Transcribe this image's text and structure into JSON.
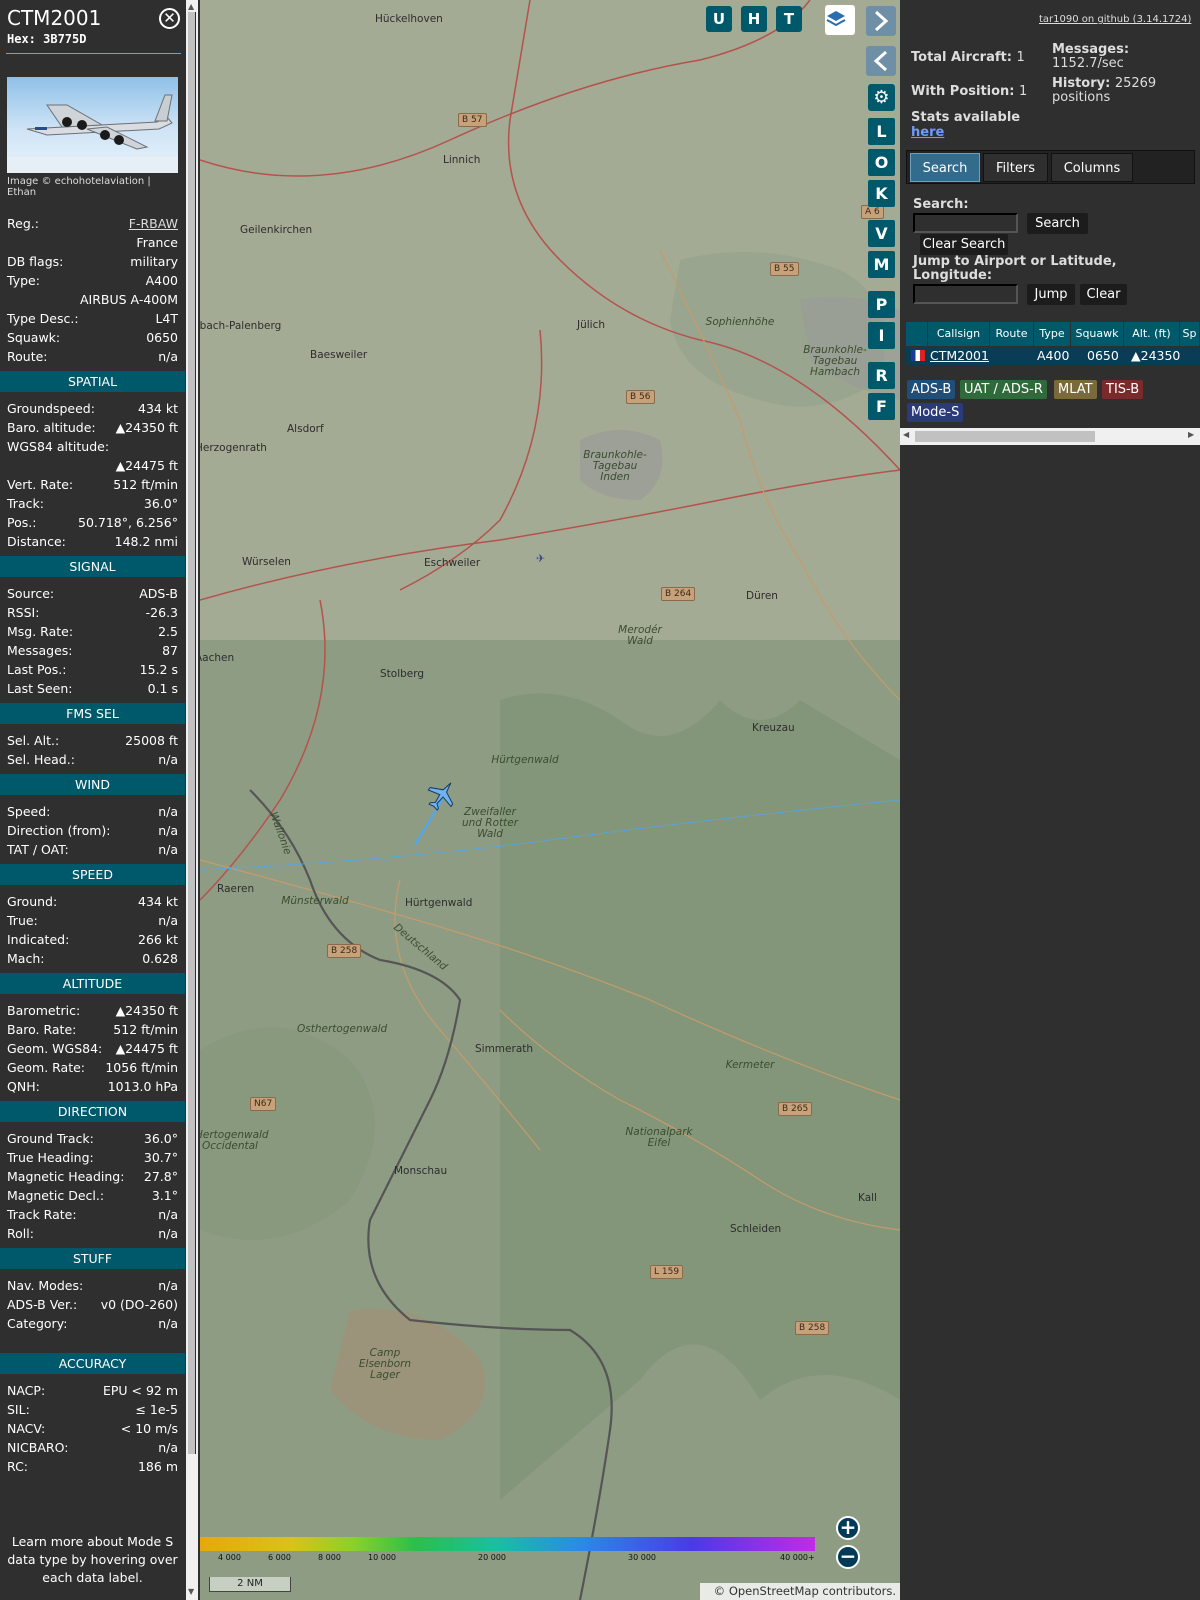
{
  "selected": {
    "callsign": "CTM2001",
    "hex": "Hex: 3B775D",
    "photo_credit": "Image © echohotelaviation | Ethan",
    "info": [
      {
        "k": "Reg.:",
        "v": "F-RBAW"
      },
      {
        "k": "",
        "v": "France"
      },
      {
        "k": "DB flags:",
        "v": "military"
      },
      {
        "k": "Type:",
        "v": "A400"
      },
      {
        "k": "",
        "v": "AIRBUS A-400M"
      },
      {
        "k": "Type Desc.:",
        "v": "L4T"
      },
      {
        "k": "Squawk:",
        "v": "0650"
      },
      {
        "k": "Route:",
        "v": "n/a"
      }
    ],
    "sections": [
      {
        "title": "SPATIAL",
        "rows": [
          {
            "k": "Groundspeed:",
            "v": "434 kt"
          },
          {
            "k": "Baro. altitude:",
            "v": "▲24350 ft"
          },
          {
            "k": "WGS84 altitude:",
            "v": ""
          },
          {
            "k": "",
            "v": "▲24475 ft"
          },
          {
            "k": "Vert. Rate:",
            "v": "512 ft/min"
          },
          {
            "k": "Track:",
            "v": "36.0°"
          },
          {
            "k": "Pos.:",
            "v": "50.718°, 6.256°"
          },
          {
            "k": "Distance:",
            "v": "148.2 nmi"
          }
        ]
      },
      {
        "title": "SIGNAL",
        "rows": [
          {
            "k": "Source:",
            "v": "ADS-B"
          },
          {
            "k": "RSSI:",
            "v": "-26.3"
          },
          {
            "k": "Msg. Rate:",
            "v": "2.5"
          },
          {
            "k": "Messages:",
            "v": "87"
          },
          {
            "k": "Last Pos.:",
            "v": "15.2 s"
          },
          {
            "k": "Last Seen:",
            "v": "0.1 s"
          }
        ]
      },
      {
        "title": "FMS SEL",
        "rows": [
          {
            "k": "Sel. Alt.:",
            "v": "25008 ft"
          },
          {
            "k": "Sel. Head.:",
            "v": "n/a"
          }
        ]
      },
      {
        "title": "WIND",
        "rows": [
          {
            "k": "Speed:",
            "v": "n/a"
          },
          {
            "k": "Direction (from):",
            "v": "n/a"
          },
          {
            "k": "TAT / OAT:",
            "v": "n/a"
          }
        ]
      },
      {
        "title": "SPEED",
        "rows": [
          {
            "k": "Ground:",
            "v": "434 kt"
          },
          {
            "k": "True:",
            "v": "n/a"
          },
          {
            "k": "Indicated:",
            "v": "266 kt"
          },
          {
            "k": "Mach:",
            "v": "0.628"
          }
        ]
      },
      {
        "title": "ALTITUDE",
        "rows": [
          {
            "k": "Barometric:",
            "v": "▲24350 ft"
          },
          {
            "k": "Baro. Rate:",
            "v": "512 ft/min"
          },
          {
            "k": "Geom. WGS84:",
            "v": "▲24475 ft"
          },
          {
            "k": "Geom. Rate:",
            "v": "1056 ft/min"
          },
          {
            "k": "QNH:",
            "v": "1013.0 hPa"
          }
        ]
      },
      {
        "title": "DIRECTION",
        "rows": [
          {
            "k": "Ground Track:",
            "v": "36.0°"
          },
          {
            "k": "True Heading:",
            "v": "30.7°"
          },
          {
            "k": "Magnetic Heading:",
            "v": "27.8°"
          },
          {
            "k": "Magnetic Decl.:",
            "v": "3.1°"
          },
          {
            "k": "Track Rate:",
            "v": "n/a"
          },
          {
            "k": "Roll:",
            "v": "n/a"
          }
        ]
      },
      {
        "title": "STUFF",
        "rows": [
          {
            "k": "Nav. Modes:",
            "v": "n/a"
          },
          {
            "k": "ADS-B Ver.:",
            "v": "v0 (DO-260)"
          },
          {
            "k": "Category:",
            "v": "n/a"
          }
        ]
      },
      {
        "title": "ACCURACY",
        "rows": [
          {
            "k": "NACP:",
            "v": "EPU < 92 m"
          },
          {
            "k": "SIL:",
            "v": "≤ 1e-5"
          },
          {
            "k": "NACV:",
            "v": "< 10 m/s"
          },
          {
            "k": "NICBARO:",
            "v": "n/a"
          },
          {
            "k": "RC:",
            "v": "186 m"
          }
        ]
      }
    ],
    "learn_more": "Learn more about Mode S data type by hovering over each data label."
  },
  "map": {
    "top_buttons": [
      "U",
      "H",
      "T"
    ],
    "side_buttons": [
      "L",
      "O",
      "K",
      "V",
      "M",
      "P",
      "I",
      "R",
      "F"
    ],
    "icons": [
      "layers-icon",
      "chevron-right-icon",
      "expand-horizontal-icon",
      "chevron-left-icon",
      "gear-icon"
    ],
    "places": [
      {
        "name": "Hückelhoven",
        "style": "town"
      },
      {
        "name": "Linnich",
        "style": "town"
      },
      {
        "name": "Geilenkirchen",
        "style": "town"
      },
      {
        "name": "Jülich",
        "style": "town"
      },
      {
        "name": "Übach-Palenberg",
        "style": "town"
      },
      {
        "name": "Baesweiler",
        "style": "town"
      },
      {
        "name": "Alsdorf",
        "style": "town"
      },
      {
        "name": "Braunkohle-Tagebau Inden",
        "style": "area"
      },
      {
        "name": "Sophienhöhe",
        "style": "area"
      },
      {
        "name": "Braunkohle-Tagebau Hambach",
        "style": "area"
      },
      {
        "name": "Herzogenrath",
        "style": "town"
      },
      {
        "name": "Würselen",
        "style": "town"
      },
      {
        "name": "Eschweiler",
        "style": "town"
      },
      {
        "name": "Düren",
        "style": "town"
      },
      {
        "name": "Merodér Wald",
        "style": "area"
      },
      {
        "name": "Aachen",
        "style": "town"
      },
      {
        "name": "Stolberg",
        "style": "town"
      },
      {
        "name": "Hürtgenwald",
        "style": "area"
      },
      {
        "name": "Kreuzau",
        "style": "town"
      },
      {
        "name": "Zweifaller und Rotter Wald",
        "style": "area"
      },
      {
        "name": "Raeren",
        "style": "town"
      },
      {
        "name": "Münsterwald",
        "style": "area"
      },
      {
        "name": "Hürtgenwald",
        "style": "town"
      },
      {
        "name": "Deutschland",
        "style": "area"
      },
      {
        "name": "Osthertogenwald",
        "style": "area"
      },
      {
        "name": "Simmerath",
        "style": "town"
      },
      {
        "name": "Kermeter",
        "style": "area"
      },
      {
        "name": "Hertogenwald Occidental",
        "style": "area"
      },
      {
        "name": "Nationalpark Eifel",
        "style": "area"
      },
      {
        "name": "Monschau",
        "style": "town"
      },
      {
        "name": "Schleiden",
        "style": "town"
      },
      {
        "name": "Wallonie",
        "style": "area"
      },
      {
        "name": "Camp Elsenborn Lager",
        "style": "area"
      },
      {
        "name": "Kall",
        "style": "town"
      }
    ],
    "roads": [
      "B 57",
      "B 55",
      "B 56",
      "B 264",
      "B 258",
      "N67",
      "B 265",
      "L 159",
      "B 258",
      "A 6"
    ],
    "altitude_legend": [
      "4 000",
      "6 000",
      "8 000",
      "10 000",
      "20 000",
      "30 000",
      "40 000+"
    ],
    "scale": "2 NM",
    "attribution": "© OpenStreetMap contributors."
  },
  "panel": {
    "github": "tar1090 on github (3.14.1724)",
    "total_aircraft_label": "Total Aircraft:",
    "total_aircraft": "1",
    "with_position_label": "With Position:",
    "with_position": "1",
    "stats_label": "Stats available",
    "stats_link": "here",
    "messages_label": "Messages:",
    "messages_value": "1152.7/sec",
    "history_label": "History:",
    "history_value": "25269",
    "history_unit": "positions",
    "tabs": [
      "Search",
      "Filters",
      "Columns"
    ],
    "search_label": "Search:",
    "search_button": "Search",
    "clear_search_button": "Clear Search",
    "jump_label": "Jump to Airport or Latitude, Longitude:",
    "jump_button": "Jump",
    "clear_button": "Clear",
    "table": {
      "headers": [
        "",
        "Callsign",
        "Route",
        "Type",
        "Squawk",
        "Alt. (ft)",
        "Sp"
      ],
      "rows": [
        {
          "callsign": "CTM2001",
          "route": "",
          "type": "A400",
          "squawk": "0650",
          "alt": "▲24350"
        }
      ]
    },
    "sources": [
      {
        "label": "ADS-B",
        "color": "#1f4e79"
      },
      {
        "label": "UAT / ADS-R",
        "color": "#2f6b3a"
      },
      {
        "label": "MLAT",
        "color": "#7a6a3a"
      },
      {
        "label": "TIS-B",
        "color": "#7a2a2a"
      },
      {
        "label": "Mode-S",
        "color": "#2a3a7a"
      }
    ]
  }
}
